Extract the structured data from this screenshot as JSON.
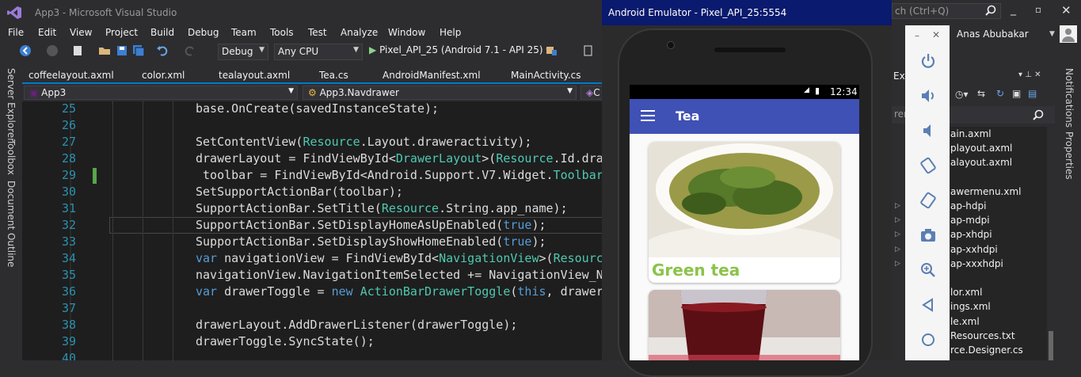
{
  "window": {
    "title": "App3 - Microsoft Visual Studio"
  },
  "menu": [
    "File",
    "Edit",
    "View",
    "Project",
    "Build",
    "Debug",
    "Team",
    "Tools",
    "Test",
    "Analyze",
    "Window",
    "Help"
  ],
  "toolbar": {
    "config": "Debug",
    "platform": "Any CPU",
    "run_target": "Pixel_API_25 (Android 7.1 - API 25)"
  },
  "tabs": [
    "coffeelayout.axml",
    "color.xml",
    "tealayout.axml",
    "Tea.cs",
    "AndroidManifest.xml",
    "MainActivity.cs"
  ],
  "navbar": {
    "project": "App3",
    "class": "App3.Navdrawer",
    "member": "C"
  },
  "left_rail": [
    "Server Explorer",
    "Toolbox",
    "Document Outline"
  ],
  "editor": {
    "lines": [
      {
        "n": "25",
        "code": "base.OnCreate(savedInstanceState);"
      },
      {
        "n": "26",
        "code": ""
      },
      {
        "n": "27",
        "code": "SetContentView(Resource.Layout.draweractivity);"
      },
      {
        "n": "28",
        "code": "drawerLayout = FindViewById<DrawerLayout>(Resource.Id.dra"
      },
      {
        "n": "29",
        "code": " toolbar = FindViewById<Android.Support.V7.Widget.Toolbar"
      },
      {
        "n": "30",
        "code": "SetSupportActionBar(toolbar);"
      },
      {
        "n": "31",
        "code": "SupportActionBar.SetTitle(Resource.String.app_name);"
      },
      {
        "n": "32",
        "code": "SupportActionBar.SetDisplayHomeAsUpEnabled(true);"
      },
      {
        "n": "33",
        "code": "SupportActionBar.SetDisplayShowHomeEnabled(true);"
      },
      {
        "n": "34",
        "code": "var navigationView = FindViewById<NavigationView>(Resource"
      },
      {
        "n": "35",
        "code": "navigationView.NavigationItemSelected += NavigationView_N"
      },
      {
        "n": "36",
        "code": "var drawerToggle = new ActionBarDrawerToggle(this, drawer"
      },
      {
        "n": "37",
        "code": ""
      },
      {
        "n": "38",
        "code": "drawerLayout.AddDrawerListener(drawerToggle);"
      },
      {
        "n": "39",
        "code": "drawerToggle.SyncState();"
      },
      {
        "n": "40",
        "code": ""
      }
    ]
  },
  "emulator": {
    "title": "Android Emulator - Pixel_API_25:5554",
    "time": "12:34",
    "app_title": "Tea",
    "card_label": "Green tea"
  },
  "right": {
    "quick_launch": "ch (Ctrl+Q)",
    "user": "Anas Abubakar",
    "search": "rer (Ctrl+;)",
    "panel_label": "Ex",
    "notifications": "Notifications",
    "properties": "Properties"
  },
  "solution_items": [
    "ain.axml",
    "playout.axml",
    "alayout.axml",
    "",
    "awermenu.xml",
    "ap-hdpi",
    "ap-mdpi",
    "ap-xhdpi",
    "ap-xxhdpi",
    "ap-xxxhdpi",
    "",
    "lor.xml",
    "ings.xml",
    "le.xml",
    "Resources.txt",
    "rce.Designer.cs"
  ],
  "colors": {
    "accent": "#007acc",
    "appbar": "#3f51b5",
    "card_label": "#8bc34a",
    "emu_title": "#0a1a6e"
  }
}
